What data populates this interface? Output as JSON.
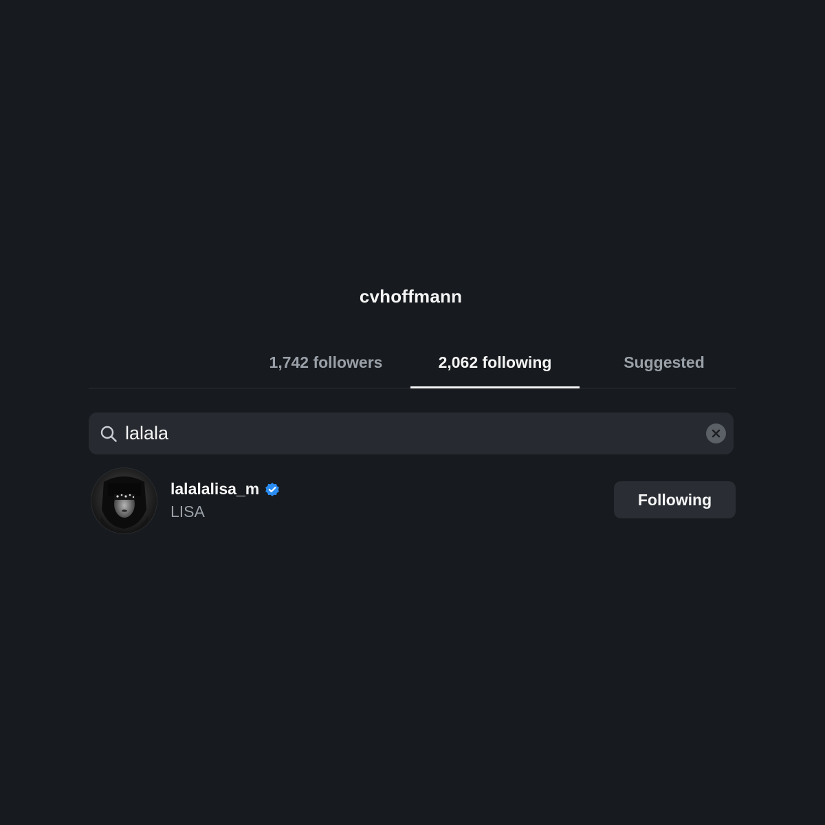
{
  "profile": {
    "username": "cvhoffmann"
  },
  "tabs": [
    {
      "label": "1,742 followers",
      "active": false
    },
    {
      "label": "2,062 following",
      "active": true
    },
    {
      "label": "Suggested",
      "active": false
    }
  ],
  "search": {
    "value": "lalala",
    "icon": "search-icon",
    "clear_icon": "clear-icon"
  },
  "results": [
    {
      "username": "lalalalisa_m",
      "full_name": "LISA",
      "verified": true,
      "button_label": "Following"
    }
  ],
  "colors": {
    "background": "#171a1e",
    "search_bg": "#272b31",
    "button_bg": "#2a2e34",
    "verified_blue": "#2a8cf0",
    "muted_text": "#9aa0a8"
  }
}
